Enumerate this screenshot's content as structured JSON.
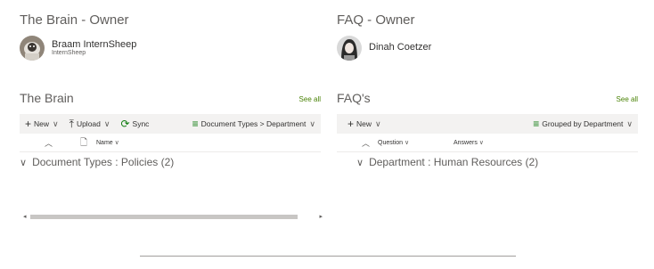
{
  "left": {
    "owner_title": "The Brain - Owner",
    "owner_name": "Braam InternSheep",
    "owner_sub": "InternSheep",
    "section_title": "The Brain",
    "see_all": "See all",
    "cmd": {
      "new": "New",
      "upload": "Upload",
      "sync": "Sync",
      "view": "Document Types > Department"
    },
    "column_name": "Name",
    "group_label": "Document Types : Policies (2)"
  },
  "right": {
    "owner_title": "FAQ - Owner",
    "owner_name": "Dinah Coetzer",
    "section_title": "FAQ's",
    "see_all": "See all",
    "cmd": {
      "new": "New",
      "view": "Grouped by Department"
    },
    "column_question": "Question",
    "column_answers": "Answers",
    "group_label": "Department : Human Resources (2)"
  },
  "icons": {
    "plus": "plus-icon",
    "upload": "upload-arrow-icon",
    "sync": "sync-icon",
    "view": "view-lines-icon",
    "chevron": "chevron-down-icon",
    "sort": "chevron-up-icon",
    "file": "file-icon"
  },
  "colors": {
    "accent": "#498205",
    "commandbar": "#f3f2f1"
  }
}
